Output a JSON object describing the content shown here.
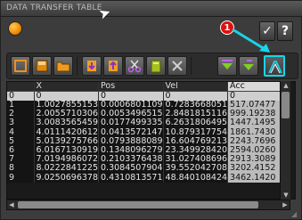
{
  "window": {
    "title": "DATA TRANSFER TABLE"
  },
  "annotation": {
    "badge": "1"
  },
  "buttons": {
    "confirm": "✓",
    "help": "?"
  },
  "toolbar": {
    "icons": [
      "new-icon",
      "save-icon",
      "open-folder-icon",
      "import-icon",
      "export-icon",
      "cut-icon",
      "clear-icon",
      "close-x-icon",
      "add-down-icon",
      "insert-down-icon",
      "plot-icon"
    ]
  },
  "table": {
    "columns": [
      "",
      "X",
      "Pos",
      "Vel",
      "Acc"
    ],
    "rows": [
      [
        "0",
        "0",
        "0",
        "0",
        "0"
      ],
      [
        "1",
        "1.0027855153",
        "0.0006801109",
        "0.7283668051",
        "517.07477"
      ],
      [
        "2",
        "2.0055710306",
        "0.0053496515",
        "2.8481815116",
        "999.19238"
      ],
      [
        "3",
        "3.0083565459",
        "0.0177499335",
        "6.2631806495",
        "1447.1495"
      ],
      [
        "4",
        "4.0111420612",
        "0.0413572147",
        "10.879317754",
        "1861.7430"
      ],
      [
        "5",
        "5.0139275766",
        "0.0793888089",
        "16.604769213",
        "2243.7696"
      ],
      [
        "6",
        "6.0167130919",
        "0.1348096279",
        "23.349928420",
        "2594.0260"
      ],
      [
        "7",
        "7.0194986072",
        "0.2103376438",
        "31.027408696",
        "2913.3089"
      ],
      [
        "8",
        "8.0222841225",
        "0.3084507904",
        "39.552042708",
        "3202.4152"
      ],
      [
        "9",
        "9.0250696378",
        "0.4310813571",
        "48.840108424",
        "3462.1420"
      ]
    ]
  }
}
